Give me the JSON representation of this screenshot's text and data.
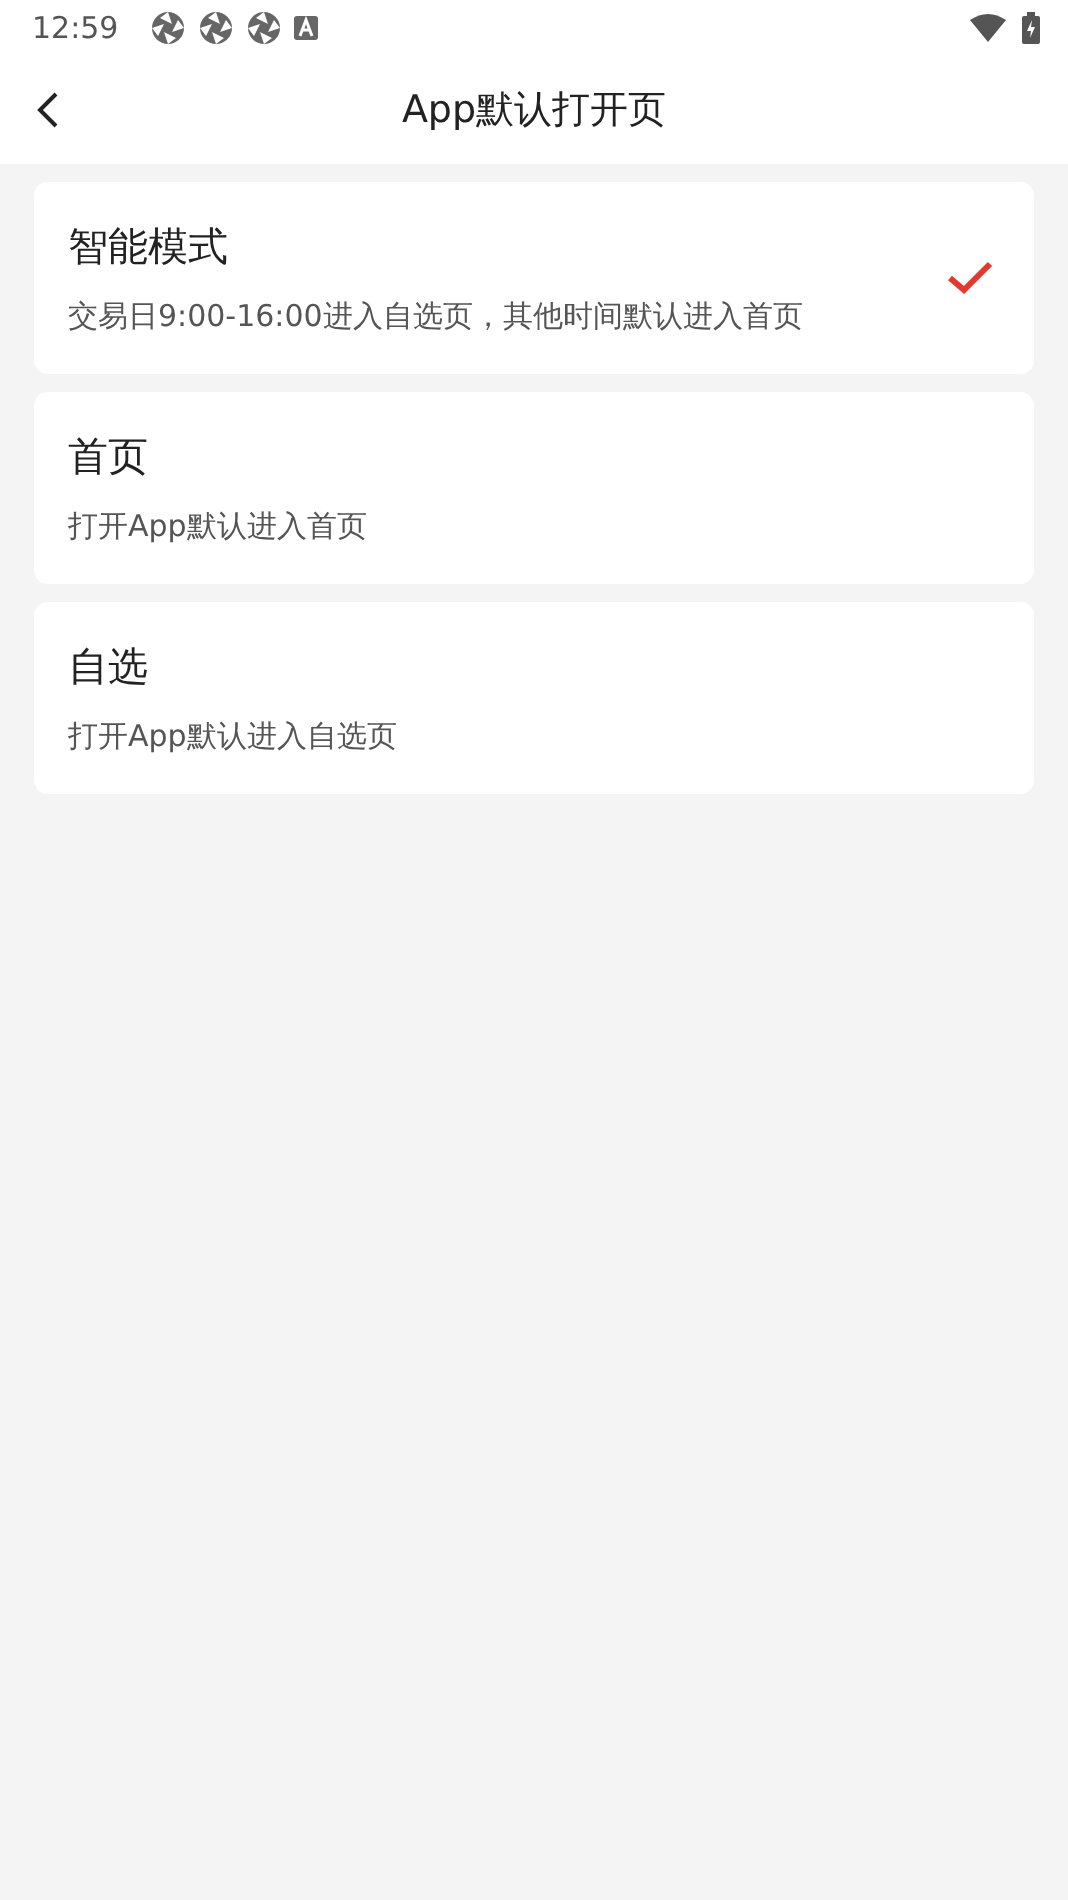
{
  "status_bar": {
    "time": "12:59"
  },
  "header": {
    "title": "App默认打开页"
  },
  "options": [
    {
      "title": "智能模式",
      "description": "交易日9:00-16:00进入自选页，其他时间默认进入首页",
      "selected": true
    },
    {
      "title": "首页",
      "description": "打开App默认进入首页",
      "selected": false
    },
    {
      "title": "自选",
      "description": "打开App默认进入自选页",
      "selected": false
    }
  ]
}
